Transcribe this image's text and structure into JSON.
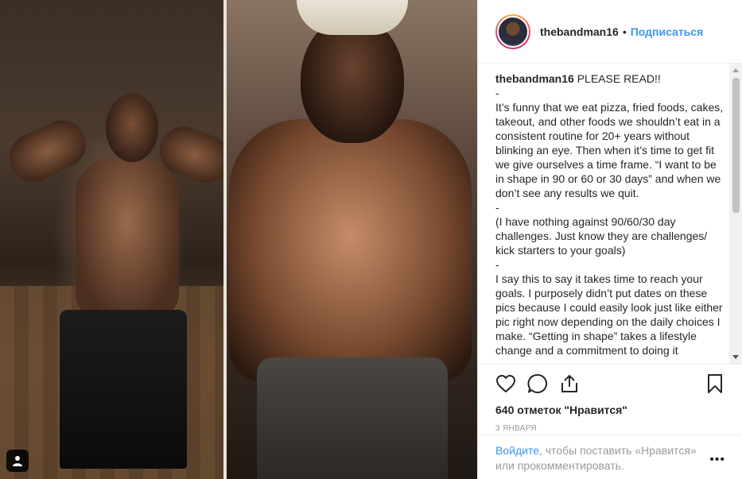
{
  "post": {
    "username": "thebandman16",
    "follow_label": "Подписаться",
    "dot": "•",
    "caption_author": "thebandman16",
    "caption_lines": [
      "PLEASE READ!!",
      "-",
      "It’s funny that we eat pizza, fried foods, cakes, takeout, and other foods we shouldn’t eat in a consistent routine for 20+ years without blinking an eye. Then when it’s time to get fit we give ourselves a time frame. “I want to be in shape in 90 or 60 or 30 days” and when we don’t see any results we quit.",
      "-",
      "(I have nothing against 90/60/30 day challenges. Just know they are challenges/ kick starters to your goals)",
      "-",
      "I say this to say it takes time to reach your goals. I purposely didn’t put dates on these pics because I could easily look just like either pic right now depending on the daily choices I make. “Getting in shape” takes a lifestyle change and a commitment to doing it"
    ],
    "likes": "640 отметок \"Нравится\"",
    "date": "3 января",
    "login_link": "Войдите",
    "login_rest": ", чтобы поставить «Нравится» или прокомментировать.",
    "more_label": "•••"
  },
  "icons": {
    "like": "heart-icon",
    "comment": "comment-icon",
    "share": "share-icon",
    "save": "bookmark-icon",
    "tag": "user-tag-icon",
    "more": "more-options-icon"
  },
  "colors": {
    "link": "#3897f0",
    "text": "#262626",
    "muted": "#999999",
    "border": "#efefef"
  }
}
